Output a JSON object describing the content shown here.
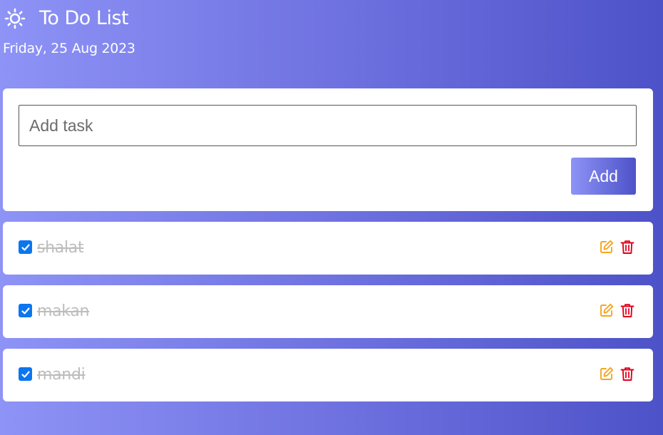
{
  "header": {
    "icon": "sun-icon",
    "title": "To Do List",
    "date": "Friday, 25 Aug 2023"
  },
  "add_form": {
    "input_value": "",
    "input_placeholder": "Add task",
    "add_label": "Add"
  },
  "tasks": [
    {
      "text": "shalat",
      "done": true
    },
    {
      "text": "makan",
      "done": true
    },
    {
      "text": "mandi",
      "done": true
    }
  ],
  "colors": {
    "gradient_start": "#8e93f6",
    "gradient_end": "#4d52c8",
    "checkbox": "#0b76ef",
    "edit": "#f5a623",
    "delete": "#e0001b",
    "done_text": "#bdbdbd"
  }
}
